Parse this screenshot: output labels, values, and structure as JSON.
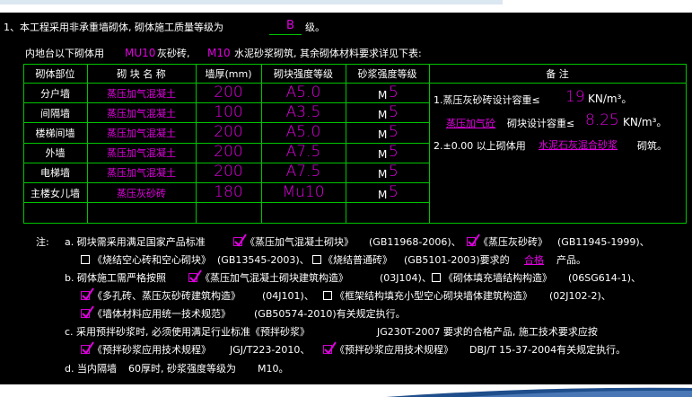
{
  "intro": {
    "line1_prefix": "1、本工程采用非承重墙砌体, 砌体施工质量等级为",
    "line1_grade": "B",
    "line1_suffix": "级。",
    "line2_prefix": "内地台以下砌体用",
    "line2_mu": "MU10",
    "line2_mid": "灰砂砖,",
    "line2_m": "M10",
    "line2_suffix": "水泥砂浆砌筑, 其余砌体材料要求详见下表:"
  },
  "table": {
    "headers": [
      "砌体部位",
      "砌 块 名 称",
      "墙厚(mm)",
      "砌块强度等级",
      "砂浆强度等级",
      "备 注"
    ],
    "rows": [
      {
        "part": "分户墙",
        "name": "蒸压加气混凝土",
        "thick": "200",
        "strength": "A5.0",
        "mortar_m": "M",
        "mortar_v": "5"
      },
      {
        "part": "间隔墙",
        "name": "蒸压加气混凝土",
        "thick": "100",
        "strength": "A3.5",
        "mortar_m": "M",
        "mortar_v": "5"
      },
      {
        "part": "楼梯间墙",
        "name": "蒸压加气混凝土",
        "thick": "200",
        "strength": "A5.0",
        "mortar_m": "M",
        "mortar_v": "5"
      },
      {
        "part": "外墙",
        "name": "蒸压加气混凝土",
        "thick": "200",
        "strength": "A7.5",
        "mortar_m": "M",
        "mortar_v": "5"
      },
      {
        "part": "电梯墙",
        "name": "蒸压加气混凝土",
        "thick": "200",
        "strength": "A7.5",
        "mortar_m": "M",
        "mortar_v": "5"
      },
      {
        "part": "主楼女儿墙",
        "name": "蒸压灰砂砖",
        "thick": "180",
        "strength": "Mu10",
        "mortar_m": "M",
        "mortar_v": "5"
      }
    ],
    "remarks": {
      "r1_prefix": "1.蒸压灰砂砖设计容重≤",
      "r1_value": "19",
      "r1_unit": "KN/m³。",
      "r2_name": "蒸压加气砼",
      "r2_mid": "砌块设计容重≤",
      "r2_value": "8.25",
      "r2_unit": "KN/m³。",
      "r3_prefix": "2.±0.00 以上砌体用",
      "r3_mortar": "水泥石灰混合砂浆",
      "r3_suffix": "砌筑。"
    }
  },
  "notes": {
    "label": "注:",
    "a1": "a. 砌块需采用满足国家产品标准",
    "a_std1": "《蒸压加气混凝土砌块》",
    "a_code1": "(GB11968-2006)、",
    "a_std2": "《蒸压灰砂砖》",
    "a_code2": "(GB11945-1999)、",
    "a2_std1": "《烧结空心砖和空心砌块》",
    "a2_code1": "(GB13545-2003)、",
    "a2_std2": "《烧结普通砖》",
    "a2_code2": "(GB5101-2003)要求的",
    "a2_grade": "合格",
    "a2_suffix": "产品。",
    "b1": "b. 砌体施工需严格按照",
    "b_std1": "《蒸压加气混凝土砌块建筑构造》",
    "b_code1": "(03J104)、",
    "b_std2": "《砌体填充墙结构构造》",
    "b_code2": "(06SG614-1)、",
    "b2_std1": "《多孔砖、蒸压灰砂砖建筑构造》",
    "b2_code1": "(04J101)、",
    "b2_std2": "《框架结构填充小型空心砌块墙体建筑构造》",
    "b2_code2": "(02J102-2)、",
    "b3_std1": "《墙体材料应用统一技术规范》",
    "b3_code1": "(GB50574-2010)有关规定执行。",
    "c1": "c. 采用预拌砂浆时, 必须使用满足行业标准《预拌砂浆》",
    "c1_code": "JG230T-2007 要求的合格产品, 施工技术要求应按",
    "c2_std1": "《预拌砂浆应用技术规程》",
    "c2_code1": "JGJ/T223-2010、",
    "c2_std2": "《预拌砂浆应用技术规程》",
    "c2_code2": "DBJ/T 15-37-2004有关规定执行。",
    "d1": "d. 当内隔墙",
    "d1_mid": "60厚时, 砂浆强度等级为",
    "d1_m": "M10。"
  }
}
